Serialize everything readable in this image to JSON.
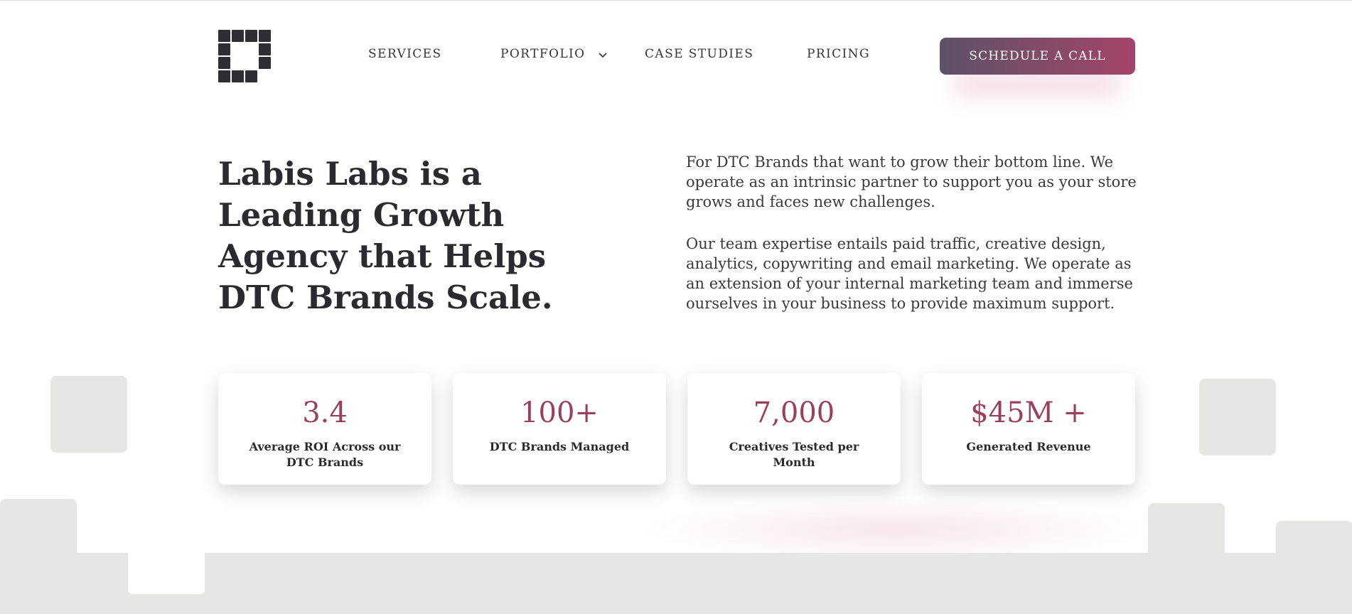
{
  "brand": {
    "logo_icon": "pixel-block-logo"
  },
  "nav": {
    "items": [
      {
        "label": "SERVICES"
      },
      {
        "label": "PORTFOLIO",
        "has_dropdown": true
      },
      {
        "label": "CASE STUDIES"
      },
      {
        "label": "PRICING"
      }
    ],
    "cta_label": "SCHEDULE A CALL"
  },
  "hero": {
    "headline": "Labis Labs is a Leading Growth Agency that Helps DTC Brands Scale.",
    "paragraph_1": "For DTC Brands that want to grow their bottom line. We operate as an intrinsic partner to support you as your store grows and faces new challenges.",
    "paragraph_2": "Our team expertise entails paid traffic, creative design, analytics, copywriting and email marketing. We operate as an extension of your internal marketing team and immerse ourselves in your business to provide maximum support."
  },
  "stats": [
    {
      "value": "3.4",
      "label": "Average ROI Across our DTC Brands"
    },
    {
      "value": "100+",
      "label": "DTC Brands Managed"
    },
    {
      "value": "7,000",
      "label": "Creatives Tested per Month"
    },
    {
      "value": "$45M +",
      "label": "Generated Revenue"
    }
  ],
  "colors": {
    "accent": "#9b3f5f",
    "cta_gradient_start": "#5d5267",
    "cta_gradient_end": "#a4456a",
    "text_dark": "#2b2b2f",
    "decor_gray": "#e6e7e4"
  }
}
